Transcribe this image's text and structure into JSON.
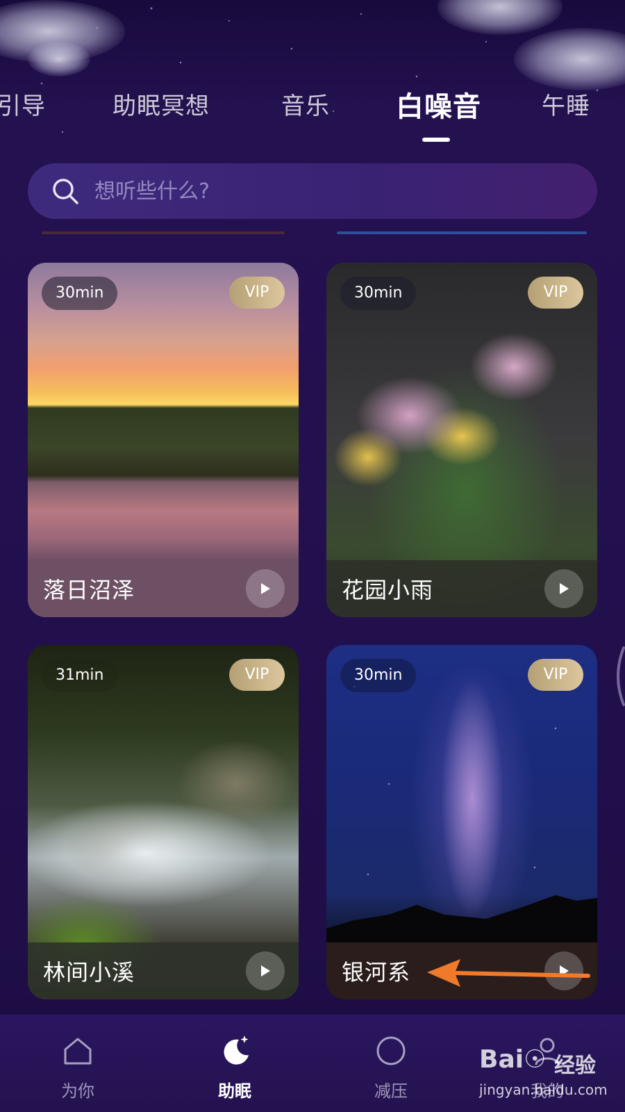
{
  "tabs": [
    {
      "label": "引导"
    },
    {
      "label": "助眠冥想"
    },
    {
      "label": "音乐"
    },
    {
      "label": "白噪音",
      "active": true
    },
    {
      "label": "午睡"
    }
  ],
  "search": {
    "placeholder": "想听些什么?",
    "icon": "search-icon"
  },
  "cards": [
    {
      "title": "落日沼泽",
      "duration": "30min",
      "badge": "VIP"
    },
    {
      "title": "花园小雨",
      "duration": "30min",
      "badge": "VIP"
    },
    {
      "title": "林间小溪",
      "duration": "31min",
      "badge": "VIP"
    },
    {
      "title": "银河系",
      "duration": "30min",
      "badge": "VIP"
    }
  ],
  "bottom_nav": [
    {
      "label": "为你",
      "icon": "house-icon"
    },
    {
      "label": "助眠",
      "icon": "moon-star-icon",
      "active": true
    },
    {
      "label": "减压",
      "icon": "circle-icon"
    },
    {
      "label": "我的",
      "icon": "person-icon"
    }
  ],
  "watermark": {
    "logo": "Bai☉",
    "text": "经验",
    "url": "jingyan.baidu.com"
  },
  "colors": {
    "background": "#23104f",
    "vip_gold": "#cdb68a",
    "annotation_arrow": "#f07a2c"
  }
}
